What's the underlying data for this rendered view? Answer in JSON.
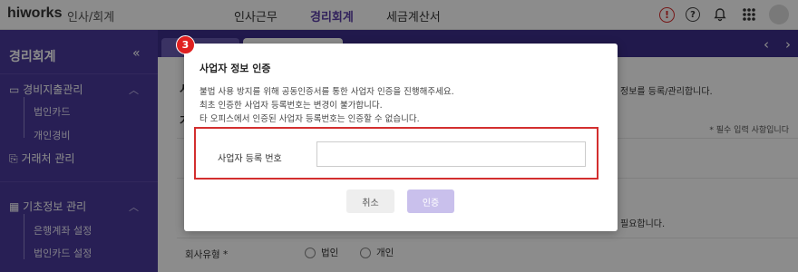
{
  "header": {
    "logo": "hiworks",
    "app_name": "인사/회계",
    "nav": [
      "인사근무",
      "경리회계",
      "세금계산서"
    ],
    "active_nav_index": 1,
    "alert_glyph": "!",
    "help_glyph": "?"
  },
  "sidebar": {
    "title": "경리회계",
    "collapse_glyph": "«",
    "sections": [
      {
        "label": "경비지출관리",
        "icon": "card-icon",
        "items": [
          "법인카드",
          "개인경비"
        ]
      },
      {
        "label": "거래처 관리",
        "icon": "document-icon",
        "items": []
      },
      {
        "label": "기초정보 관리",
        "icon": "grid-icon",
        "items": [
          "은행계좌 설정",
          "법인카드 설정"
        ]
      }
    ]
  },
  "main": {
    "fragment_a": "시",
    "fragment_b": "정보를 등록/관리합니다.",
    "fragment_c": "기",
    "required_note": "* 필수 입력 사항입니다",
    "fragment_d": "필요합니다.",
    "company_type_label": "회사유형 *",
    "company_type_options": [
      "법인",
      "개인"
    ],
    "tab_prev_glyph": "‹",
    "tab_next_glyph": "›"
  },
  "modal": {
    "step_number": "3",
    "title": "사업자 정보 인증",
    "description": [
      "불법 사용 방지를 위해 공동인증서를 통한 사업자 인증을 진행해주세요.",
      "최초 인증한 사업자 등록번호는 변경이 불가합니다.",
      "타 오피스에서 인증된 사업자 등록번호는 인증할 수 없습니다."
    ],
    "field_label": "사업자 등록 번호",
    "field_value": "",
    "field_placeholder": "",
    "cancel_label": "취소",
    "verify_label": "인증"
  },
  "colors": {
    "brand": "#4a3a9b",
    "highlight": "#d32f2f",
    "verify_disabled": "#c9c0ec"
  }
}
